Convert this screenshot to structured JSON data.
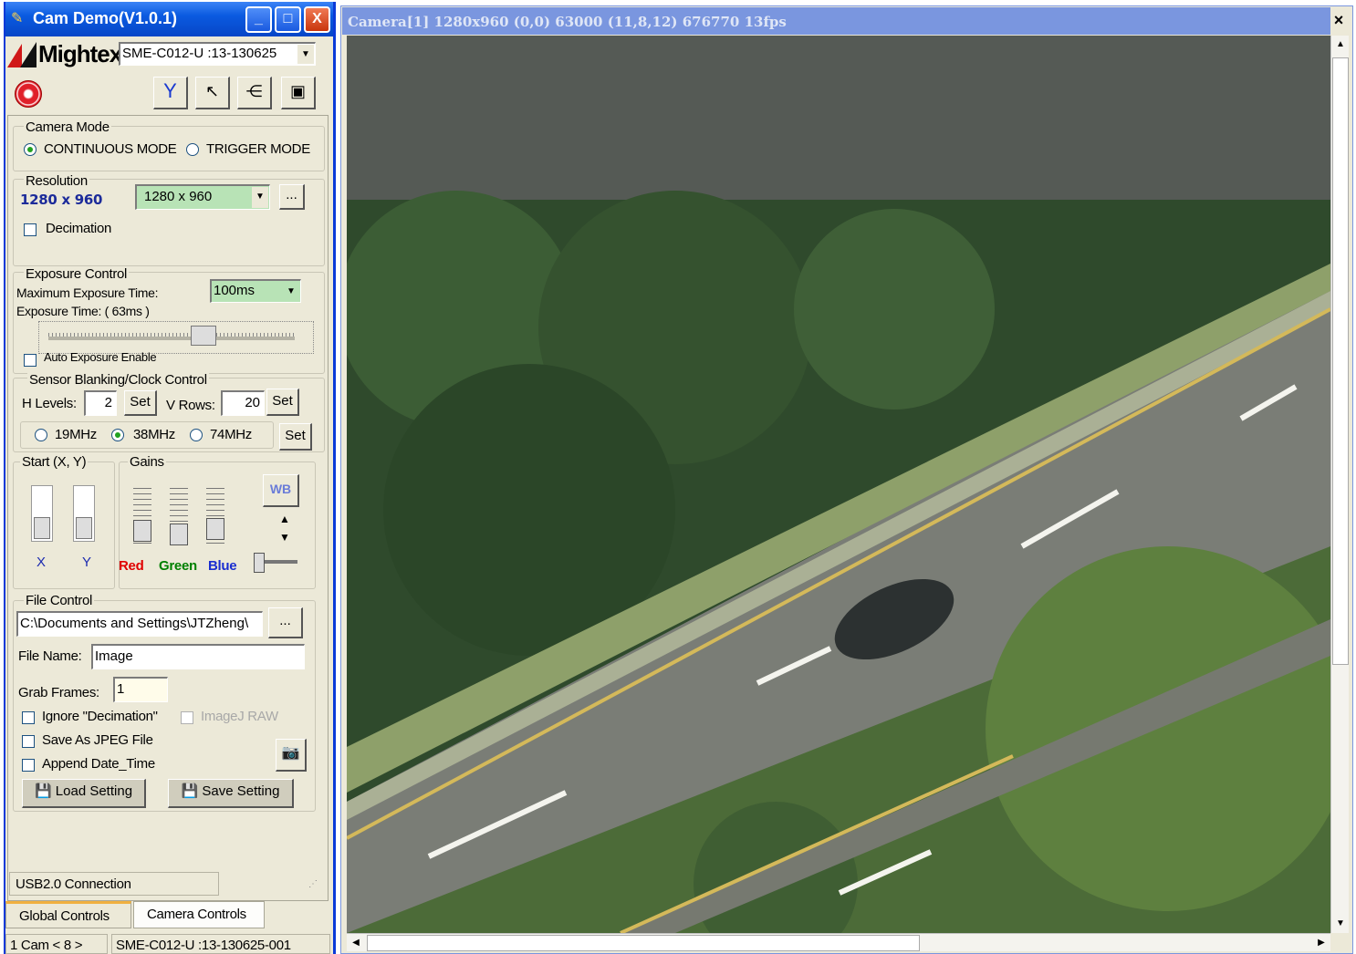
{
  "window": {
    "title": "Cam Demo(V1.0.1)",
    "minimize": "_",
    "maximize": "□",
    "close": "X"
  },
  "header": {
    "logo": "Mightex",
    "device_select": "SME-C012-U   :13-130625"
  },
  "camera_mode": {
    "title": "Camera Mode",
    "continuous": "CONTINUOUS MODE",
    "trigger": "TRIGGER MODE",
    "selected": "continuous"
  },
  "resolution": {
    "title": "Resolution",
    "current": "1280 x  960",
    "select_value": "1280 x 960",
    "more_label": "...",
    "decimation": "Decimation"
  },
  "exposure": {
    "title": "Exposure Control",
    "max_label": "Maximum  Exposure Time:",
    "max_value": "100ms",
    "time_label": "Exposure Time: ( 63ms )",
    "slider_fraction": 0.63,
    "auto_enable": "Auto Exposure Enable"
  },
  "blanking": {
    "title": "Sensor Blanking/Clock Control",
    "h_label": "H Levels:",
    "h_value": "2",
    "set": "Set",
    "v_label": "V Rows:",
    "v_value": "20",
    "clock_19": "19MHz",
    "clock_38": "38MHz",
    "clock_74": "74MHz",
    "clock_selected": "38MHz"
  },
  "start": {
    "title": "Start (X, Y)",
    "x": "X",
    "y": "Y"
  },
  "gains": {
    "title": "Gains",
    "red": "Red",
    "green": "Green",
    "blue": "Blue",
    "wb": "WB",
    "colors": {
      "red": "#e00000",
      "green": "#008000",
      "blue": "#1a2ed0"
    }
  },
  "file_control": {
    "title": "File Control",
    "path": "C:\\Documents and Settings\\JTZheng\\",
    "browse": "...",
    "filename_label": "File Name:",
    "filename": "Image",
    "grab_label": "Grab Frames:",
    "grab_value": "1",
    "ignore_decimation": "Ignore \"Decimation\"",
    "imagej_raw": "ImageJ RAW",
    "save_jpeg": "Save As JPEG File",
    "append_date": "Append Date_Time",
    "load_setting": "Load Setting",
    "save_setting": "Save Setting"
  },
  "status": {
    "connection": "USB2.0 Connection",
    "tab_global": "Global  Controls",
    "tab_camera": "Camera Controls",
    "cam_count": "1 Cam < 8 >",
    "device_id": "SME-C012-U   :13-130625-001"
  },
  "camera_view": {
    "title": "Camera[1]   1280x960 (0,0) 63000 (11,8,12) 676770 13fps",
    "close": "×"
  }
}
